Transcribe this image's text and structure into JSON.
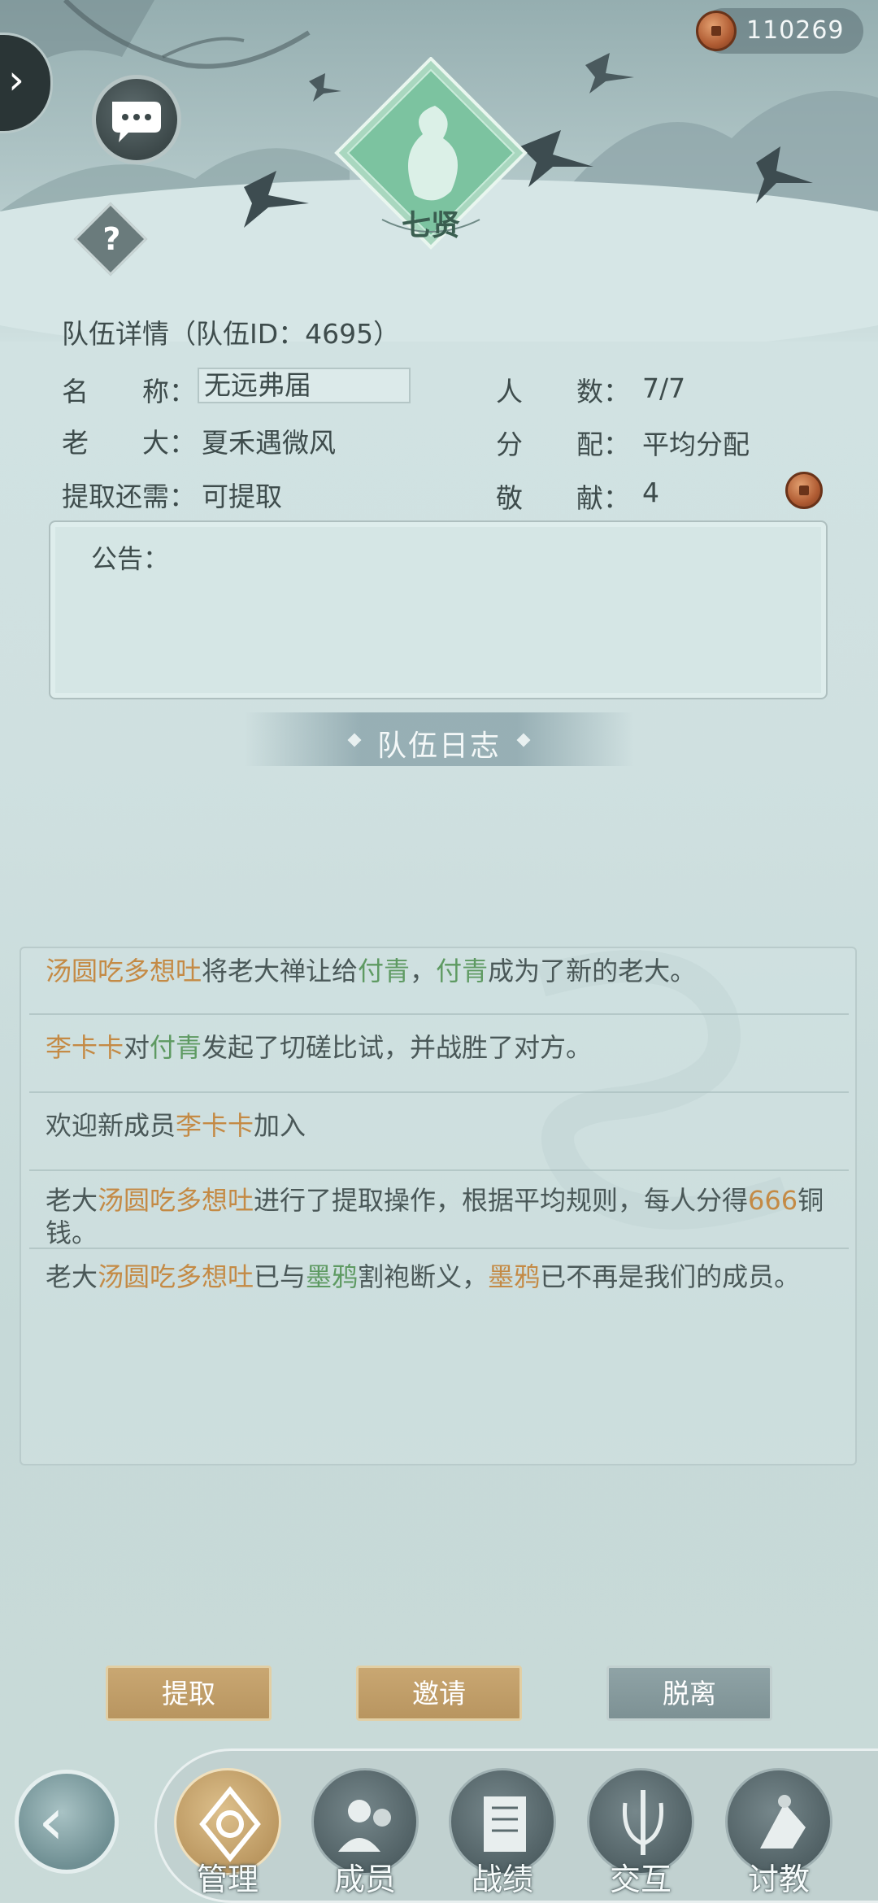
{
  "currency": {
    "amount": "110269",
    "icon": "copper-coin-icon"
  },
  "emblem": {
    "label": "七贤"
  },
  "team_info": {
    "title": "队伍详情（队伍ID：4695）",
    "name_label": "名　　称：",
    "name_value": "无远弗届",
    "members_label": "人　　数：",
    "members_value": "7/7",
    "leader_label": "老　　大：",
    "leader_value": "夏禾遇微风",
    "distribution_label": "分　　配：",
    "distribution_value": "平均分配",
    "withdraw_label": "提取还需：",
    "withdraw_value": "可提取",
    "contribution_label": "敬　　献：",
    "contribution_value": "4"
  },
  "notice": {
    "label": "公告："
  },
  "log": {
    "title": "队伍日志",
    "entries": [
      {
        "parts": [
          [
            "汤圆吃多想吐",
            "orange"
          ],
          [
            "将老大禅让给",
            ""
          ],
          [
            "付青",
            "green"
          ],
          [
            "，",
            ""
          ],
          [
            "付青",
            "green"
          ],
          [
            "成为了新的老大。",
            ""
          ]
        ]
      },
      {
        "parts": [
          [
            "李卡卡",
            "orange"
          ],
          [
            "对",
            ""
          ],
          [
            "付青",
            "green"
          ],
          [
            "发起了切磋比试，并战胜了对方。",
            ""
          ]
        ]
      },
      {
        "parts": [
          [
            "欢迎新成员",
            ""
          ],
          [
            "李卡卡",
            "orange"
          ],
          [
            "加入",
            ""
          ]
        ]
      },
      {
        "parts": [
          [
            "老大",
            ""
          ],
          [
            "汤圆吃多想吐",
            "orange"
          ],
          [
            "进行了提取操作，根据平均规则，每人分得",
            ""
          ],
          [
            "666",
            "orange"
          ],
          [
            "铜钱。",
            ""
          ]
        ]
      },
      {
        "parts": [
          [
            "老大",
            ""
          ],
          [
            "汤圆吃多想吐",
            "orange"
          ],
          [
            "已与",
            ""
          ],
          [
            "墨鸦",
            "green"
          ],
          [
            "割袍断义，",
            ""
          ],
          [
            "墨鸦",
            "orange"
          ],
          [
            "已不再是我们的成员。",
            ""
          ]
        ]
      }
    ]
  },
  "actions": {
    "withdraw": "提取",
    "invite": "邀请",
    "leave": "脱离"
  },
  "nav": {
    "items": [
      {
        "label": "管理",
        "icon": "manage-icon",
        "active": true
      },
      {
        "label": "成员",
        "icon": "members-icon",
        "active": false
      },
      {
        "label": "战绩",
        "icon": "record-scroll-icon",
        "active": false
      },
      {
        "label": "交互",
        "icon": "interact-swords-icon",
        "active": false
      },
      {
        "label": "讨教",
        "icon": "spar-icon",
        "active": false
      }
    ]
  },
  "colors": {
    "highlight_name": "#c48a45",
    "highlight_target": "#5e9a62",
    "gold_button": "#c2a06b",
    "grey_button": "#879b9e"
  }
}
